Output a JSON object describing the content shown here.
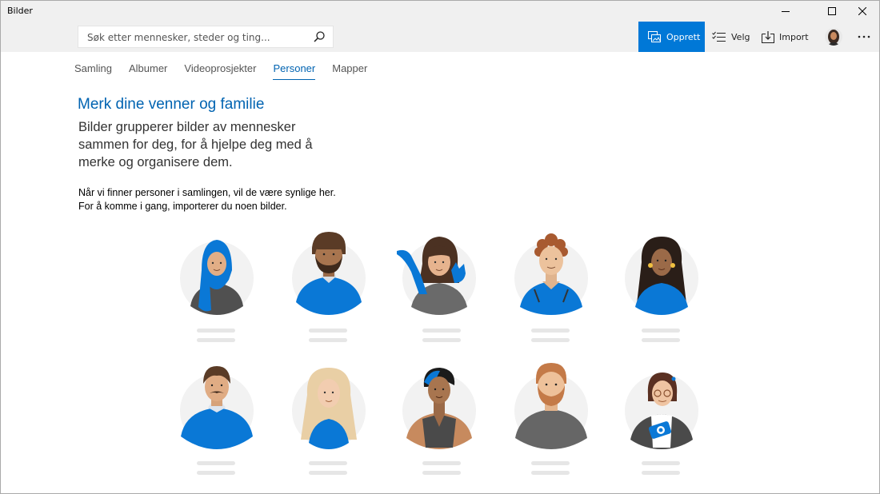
{
  "window": {
    "title": "Bilder"
  },
  "search": {
    "placeholder": "Søk etter mennesker, steder og ting...",
    "icon": "search-icon"
  },
  "commands": {
    "create_label": "Opprett",
    "select_label": "Velg",
    "import_label": "Import"
  },
  "tabs": [
    {
      "label": "Samling",
      "active": false
    },
    {
      "label": "Albumer",
      "active": false
    },
    {
      "label": "Videoprosjekter",
      "active": false
    },
    {
      "label": "Personer",
      "active": true
    },
    {
      "label": "Mapper",
      "active": false
    }
  ],
  "intro": {
    "headline": "Merk dine venner og familie",
    "subtitle": "Bilder grupperer bilder av mennesker sammen for deg, for å hjelpe deg med å merke og organisere dem.",
    "info_line1": "Når vi finner personer i samlingen, vil de være synlige her.",
    "info_line2": "For å komme i gang, importerer du noen bilder."
  },
  "colors": {
    "accent": "#0078d7",
    "link": "#0063b1",
    "chrome": "#f0f0f0"
  }
}
